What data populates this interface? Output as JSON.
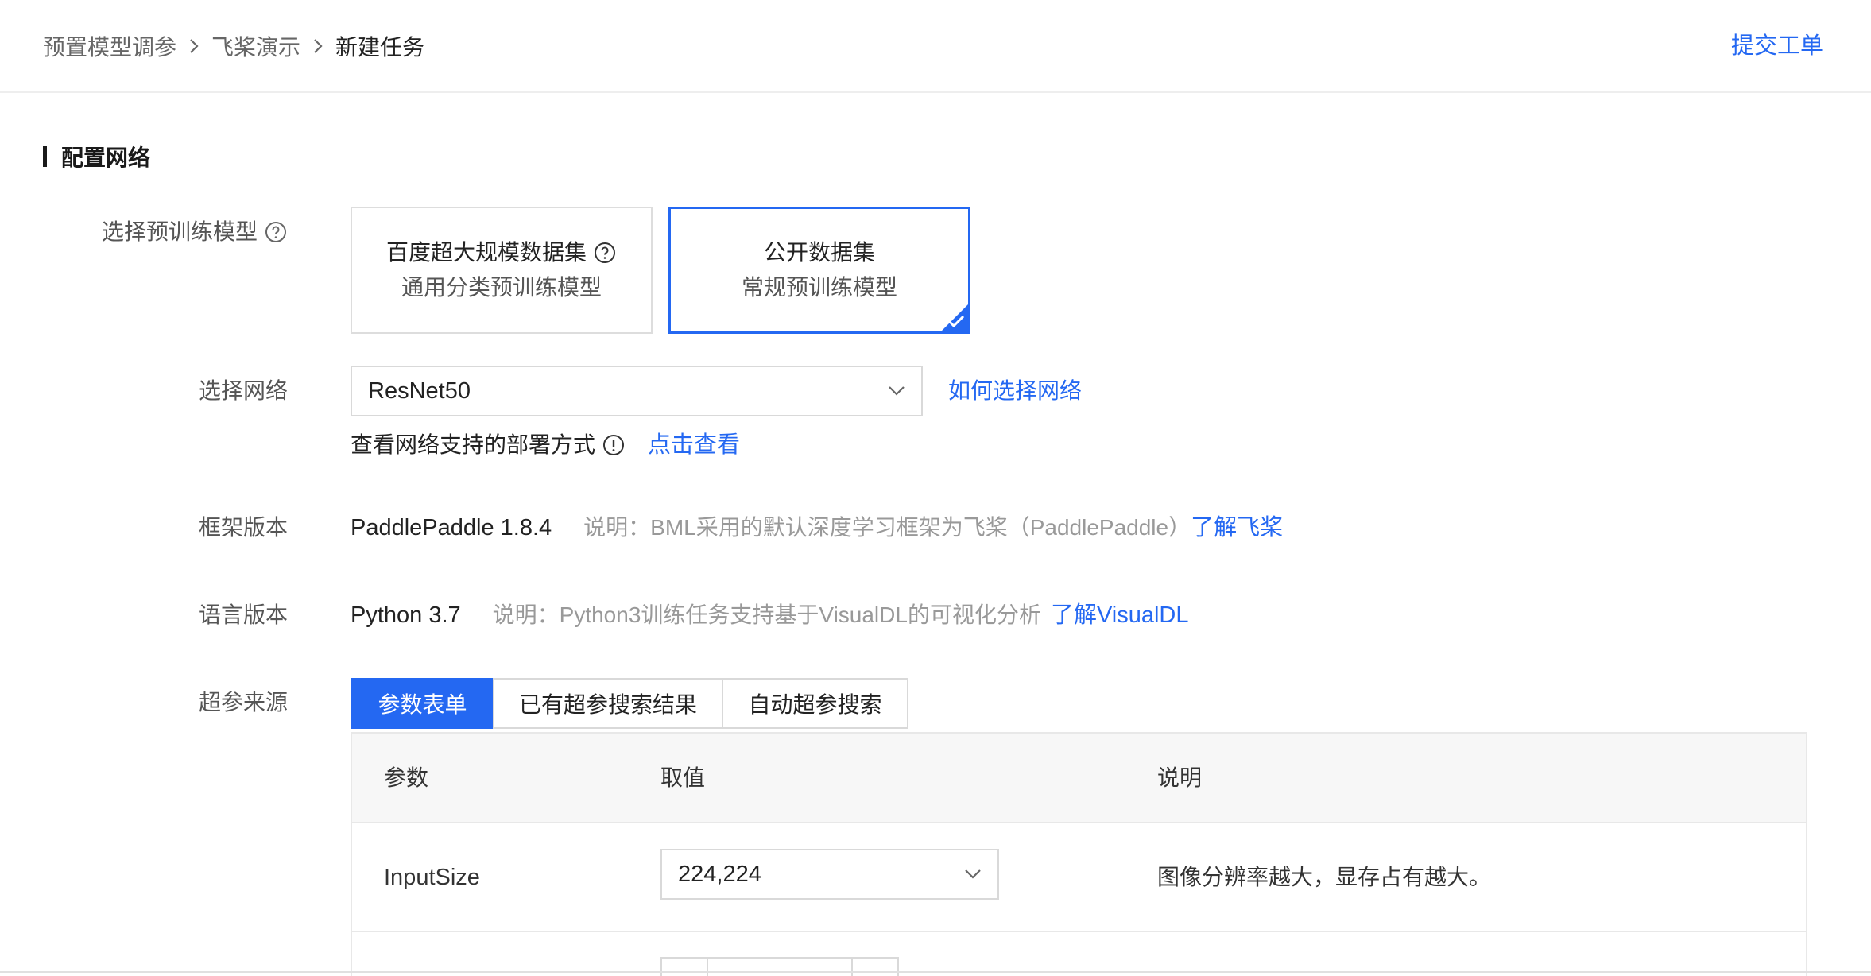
{
  "breadcrumb": {
    "items": [
      "预置模型调参",
      "飞桨演示",
      "新建任务"
    ]
  },
  "header": {
    "submit_ticket": "提交工单"
  },
  "section": {
    "title": "配置网络"
  },
  "pretrain": {
    "label": "选择预训练模型",
    "cards": [
      {
        "title": "百度超大规模数据集",
        "subtitle": "通用分类预训练模型",
        "selected": false
      },
      {
        "title": "公开数据集",
        "subtitle": "常规预训练模型",
        "selected": true
      }
    ]
  },
  "network": {
    "label": "选择网络",
    "selected": "ResNet50",
    "help_link": "如何选择网络",
    "deploy_text": "查看网络支持的部署方式",
    "deploy_link": "点击查看"
  },
  "framework": {
    "label": "框架版本",
    "value": "PaddlePaddle 1.8.4",
    "note": "说明：BML采用的默认深度学习框架为飞桨（PaddlePaddle）",
    "link": "了解飞桨"
  },
  "language": {
    "label": "语言版本",
    "value": "Python 3.7",
    "note": "说明：Python3训练任务支持基于VisualDL的可视化分析",
    "link": "了解VisualDL"
  },
  "hyperparam": {
    "label": "超参来源",
    "tabs": [
      "参数表单",
      "已有超参搜索结果",
      "自动超参搜索"
    ],
    "active_tab": 0
  },
  "table": {
    "headers": [
      "参数",
      "取值",
      "说明"
    ],
    "rows": [
      {
        "param": "InputSize",
        "value": "224,224",
        "desc": "图像分辨率越大，显存占有越大。"
      }
    ]
  },
  "colors": {
    "accent": "#2468f2",
    "muted_text": "#999999",
    "border": "#d9d9d9"
  }
}
